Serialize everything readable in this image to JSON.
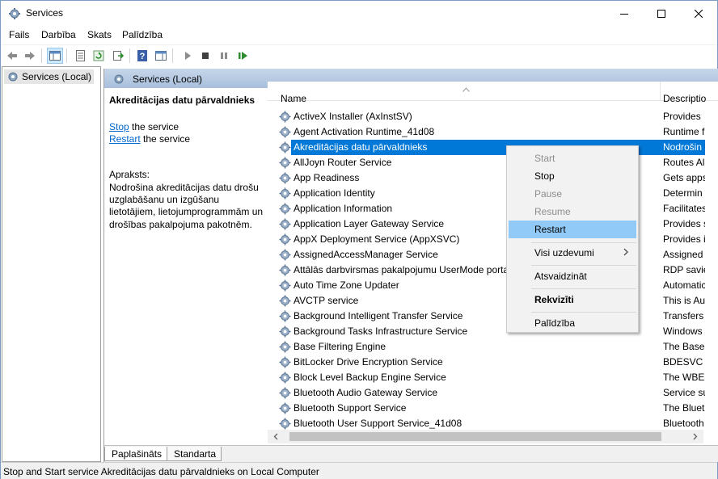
{
  "window": {
    "title": "Services",
    "minimize_icon": "minimize-icon",
    "maximize_icon": "maximize-icon",
    "close_icon": "close-icon"
  },
  "menu": [
    "Fails",
    "Darbība",
    "Skats",
    "Palīdzība"
  ],
  "tree": {
    "root_label": "Services (Local)"
  },
  "pane": {
    "header_title": "Services (Local)",
    "selected_service": "Akreditācijas datu pārvaldnieks",
    "stop_link": "Stop",
    "stop_suffix": " the service",
    "restart_link": "Restart",
    "restart_suffix": " the service",
    "description_label": "Apraksts:",
    "description_text": "Nodrošina akreditācijas datu drošu uzglabāšanu un izgūšanu lietotājiem, lietojumprogrammām un drošības pakalpojuma pakotnēm."
  },
  "columns": {
    "name": "Name",
    "description": "Descriptio"
  },
  "services": [
    {
      "name": "ActiveX Installer (AxInstSV)",
      "desc": "Provides"
    },
    {
      "name": "Agent Activation Runtime_41d08",
      "desc": "Runtime f"
    },
    {
      "name": "Akreditācijas datu pārvaldnieks",
      "desc": "Nodrošin",
      "selected": true
    },
    {
      "name": "AllJoyn Router Service",
      "desc": "Routes Al"
    },
    {
      "name": "App Readiness",
      "desc": "Gets apps"
    },
    {
      "name": "Application Identity",
      "desc": "Determin"
    },
    {
      "name": "Application Information",
      "desc": "Facilitates"
    },
    {
      "name": "Application Layer Gateway Service",
      "desc": "Provides s"
    },
    {
      "name": "AppX Deployment Service (AppXSVC)",
      "desc": "Provides i"
    },
    {
      "name": "AssignedAccessManager Service",
      "desc": "Assigned"
    },
    {
      "name": "Attālās darbvirsmas pakalpojumu UserMode porta",
      "desc": "RDP savie"
    },
    {
      "name": "Auto Time Zone Updater",
      "desc": "Automatic"
    },
    {
      "name": "AVCTP service",
      "desc": "This is Au"
    },
    {
      "name": "Background Intelligent Transfer Service",
      "desc": "Transfers"
    },
    {
      "name": "Background Tasks Infrastructure Service",
      "desc": "Windows"
    },
    {
      "name": "Base Filtering Engine",
      "desc": "The Base"
    },
    {
      "name": "BitLocker Drive Encryption Service",
      "desc": "BDESVC h"
    },
    {
      "name": "Block Level Backup Engine Service",
      "desc": "The WBEN"
    },
    {
      "name": "Bluetooth Audio Gateway Service",
      "desc": "Service su"
    },
    {
      "name": "Bluetooth Support Service",
      "desc": "The Bluet"
    },
    {
      "name": "Bluetooth User Support Service_41d08",
      "desc": "Bluetooth"
    }
  ],
  "context_menu": {
    "start": "Start",
    "stop": "Stop",
    "pause": "Pause",
    "resume": "Resume",
    "restart": "Restart",
    "all_tasks": "Visi uzdevumi",
    "refresh": "Atsvaidzināt",
    "properties": "Rekvizīti",
    "help": "Palīdzība"
  },
  "tabs": {
    "extended": "Paplašināts",
    "standard": "Standarta"
  },
  "status": "Stop and Start service Akreditācijas datu pārvaldnieks on Local Computer",
  "colors": {
    "selection": "#0078d7",
    "menu_highlight": "#91c9f7",
    "link": "#0066cc"
  }
}
